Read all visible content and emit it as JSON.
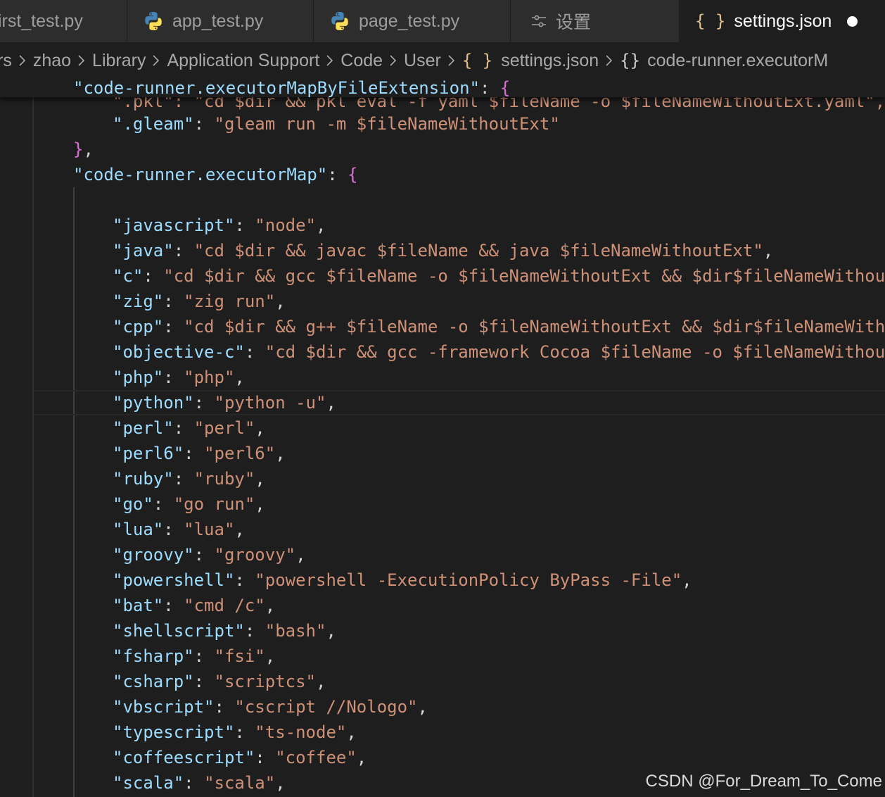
{
  "tabs": [
    {
      "label": "first_test.py",
      "icon": "python-icon",
      "active": false
    },
    {
      "label": "app_test.py",
      "icon": "python-icon",
      "active": false
    },
    {
      "label": "page_test.py",
      "icon": "python-icon",
      "active": false
    },
    {
      "label": "设置",
      "icon": "settings-sliders-icon",
      "active": false
    },
    {
      "label": "settings.json",
      "icon": "json-braces-icon",
      "active": true,
      "modified": true
    }
  ],
  "breadcrumbs": [
    "rs",
    "zhao",
    "Library",
    "Application Support",
    "Code",
    "User",
    "settings.json",
    "code-runner.executorM"
  ],
  "editor": {
    "sticky_key": "\"code-runner.executorMapByFileExtension\"",
    "partial_line": "\".pkl\": \"cd $dir && pkl eval -f yaml $fileName -o $fileNameWithoutExt.yaml\",",
    "gleam_key": "\".gleam\"",
    "gleam_value": "\"gleam run -m $fileNameWithoutExt\"",
    "map_key": "\"code-runner.executorMap\"",
    "entries": [
      {
        "key": "\"javascript\"",
        "value": "\"node\""
      },
      {
        "key": "\"java\"",
        "value": "\"cd $dir && javac $fileName && java $fileNameWithoutExt\""
      },
      {
        "key": "\"c\"",
        "value": "\"cd $dir && gcc $fileName -o $fileNameWithoutExt && $dir$fileNameWithou"
      },
      {
        "key": "\"zig\"",
        "value": "\"zig run\""
      },
      {
        "key": "\"cpp\"",
        "value": "\"cd $dir && g++ $fileName -o $fileNameWithoutExt && $dir$fileNameWith"
      },
      {
        "key": "\"objective-c\"",
        "value": "\"cd $dir && gcc -framework Cocoa $fileName -o $fileNameWithou"
      },
      {
        "key": "\"php\"",
        "value": "\"php\""
      },
      {
        "key": "\"python\"",
        "value": "\"python -u\""
      },
      {
        "key": "\"perl\"",
        "value": "\"perl\""
      },
      {
        "key": "\"perl6\"",
        "value": "\"perl6\""
      },
      {
        "key": "\"ruby\"",
        "value": "\"ruby\""
      },
      {
        "key": "\"go\"",
        "value": "\"go run\""
      },
      {
        "key": "\"lua\"",
        "value": "\"lua\""
      },
      {
        "key": "\"groovy\"",
        "value": "\"groovy\""
      },
      {
        "key": "\"powershell\"",
        "value": "\"powershell -ExecutionPolicy ByPass -File\""
      },
      {
        "key": "\"bat\"",
        "value": "\"cmd /c\""
      },
      {
        "key": "\"shellscript\"",
        "value": "\"bash\""
      },
      {
        "key": "\"fsharp\"",
        "value": "\"fsi\""
      },
      {
        "key": "\"csharp\"",
        "value": "\"scriptcs\""
      },
      {
        "key": "\"vbscript\"",
        "value": "\"cscript //Nologo\""
      },
      {
        "key": "\"typescript\"",
        "value": "\"ts-node\""
      },
      {
        "key": "\"coffeescript\"",
        "value": "\"coffee\""
      },
      {
        "key": "\"scala\"",
        "value": "\"scala\""
      }
    ]
  },
  "watermark": "CSDN @For_Dream_To_Come",
  "colors": {
    "key": "#9cdcfe",
    "string": "#ce9178",
    "brace": "#da70d6",
    "editor_bg": "#1e1e1e",
    "json_icon": "#e2c08d"
  }
}
